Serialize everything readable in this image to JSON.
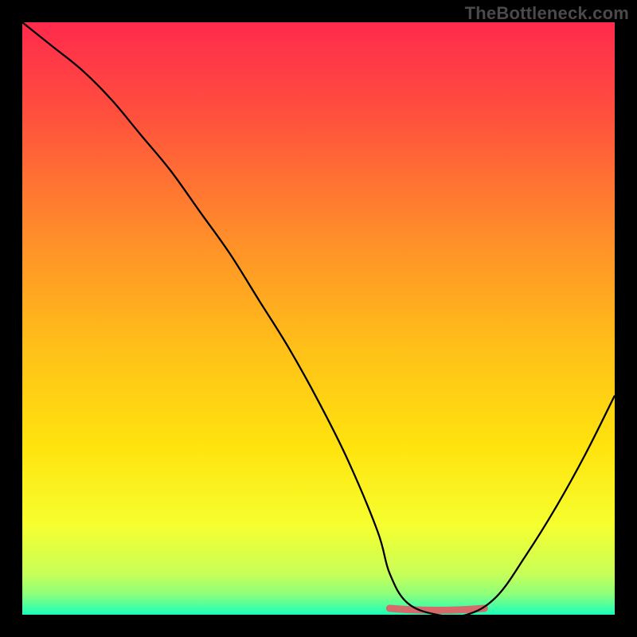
{
  "watermark": "TheBottleneck.com",
  "chart_data": {
    "type": "line",
    "title": "",
    "xlabel": "",
    "ylabel": "",
    "xlim": [
      0,
      100
    ],
    "ylim": [
      0,
      100
    ],
    "grid": false,
    "series": [
      {
        "name": "curve",
        "x": [
          0,
          5,
          10,
          15,
          20,
          25,
          30,
          35,
          40,
          45,
          50,
          55,
          60,
          62,
          65,
          70,
          75,
          80,
          85,
          90,
          95,
          100
        ],
        "values": [
          100,
          96,
          92,
          87,
          81,
          75,
          68,
          61,
          53,
          45,
          36,
          26,
          14,
          7,
          2,
          0,
          0,
          3,
          10,
          18,
          27,
          37
        ]
      }
    ],
    "gradient_stops": [
      {
        "offset": 0.0,
        "color": "#ff2a4d"
      },
      {
        "offset": 0.15,
        "color": "#ff4e3e"
      },
      {
        "offset": 0.35,
        "color": "#ff8a2b"
      },
      {
        "offset": 0.55,
        "color": "#ffc018"
      },
      {
        "offset": 0.72,
        "color": "#ffe40e"
      },
      {
        "offset": 0.85,
        "color": "#f6ff30"
      },
      {
        "offset": 0.93,
        "color": "#c8ff57"
      },
      {
        "offset": 0.965,
        "color": "#8fff7a"
      },
      {
        "offset": 0.985,
        "color": "#4dffa0"
      },
      {
        "offset": 1.0,
        "color": "#18ffb8"
      }
    ],
    "bottom_highlight": {
      "x_start": 62,
      "x_end": 78,
      "color": "#d66a6a"
    }
  }
}
